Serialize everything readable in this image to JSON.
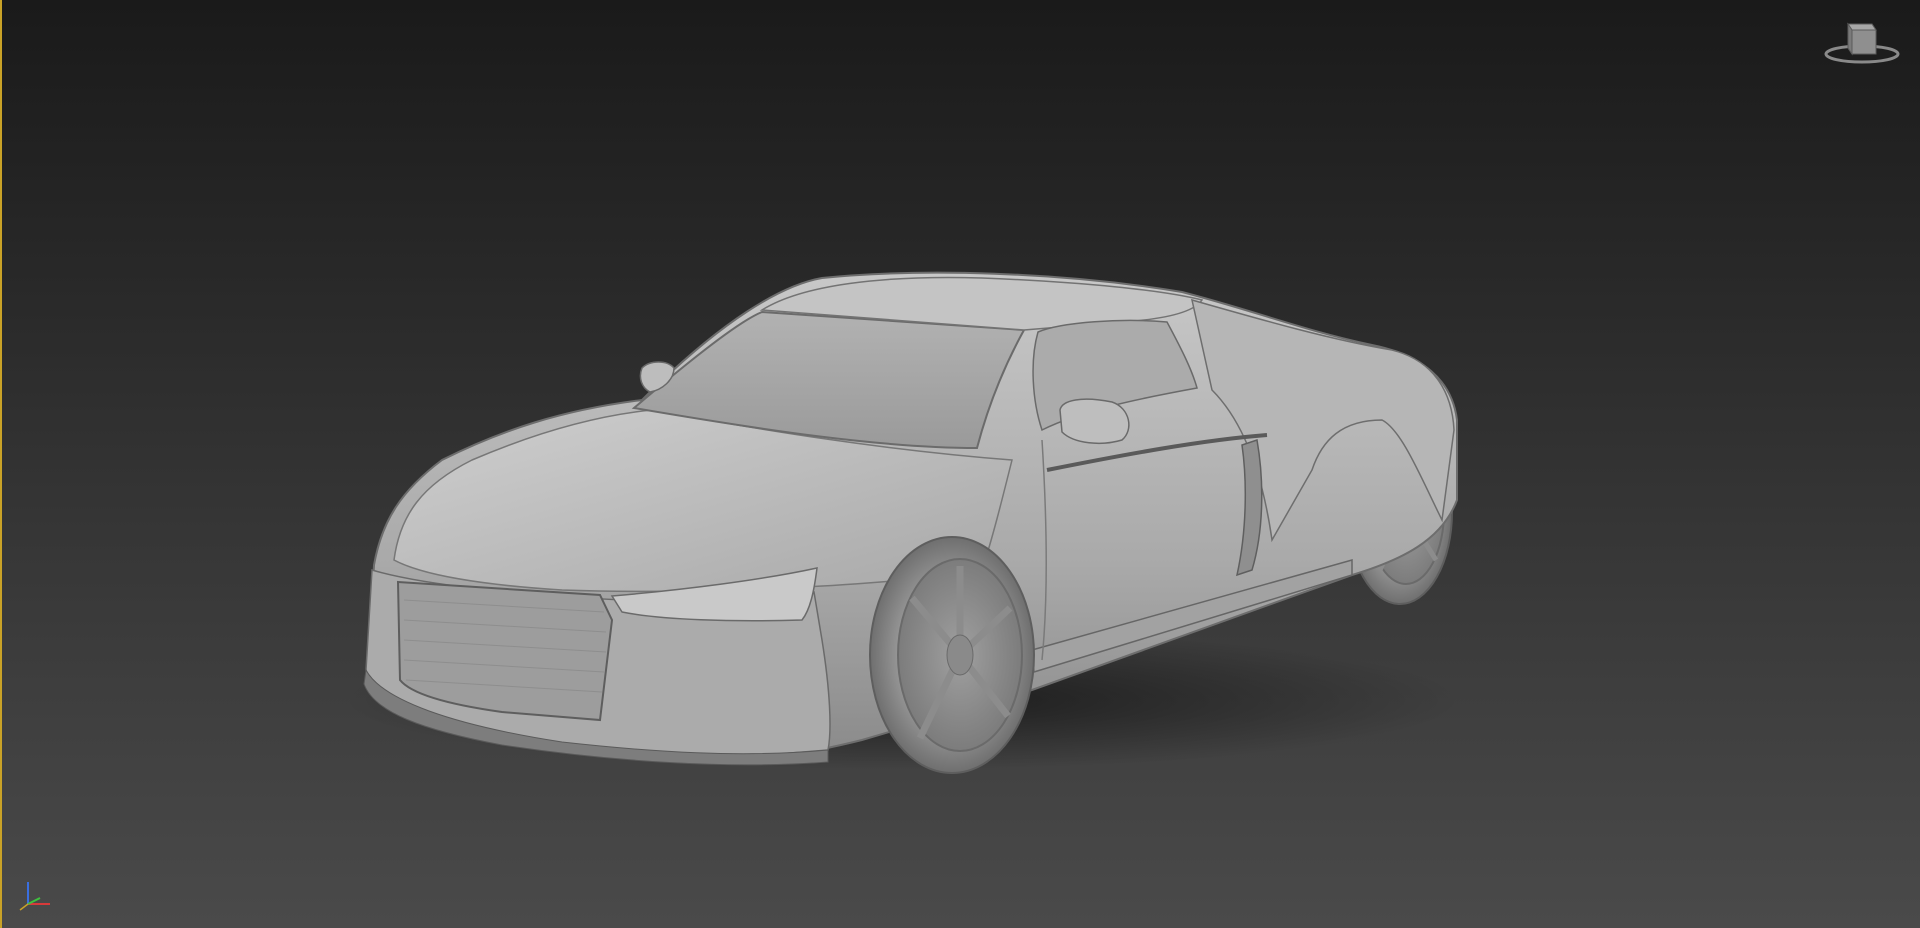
{
  "viewport": {
    "border_color": "#c9a227",
    "background_top": "#1a1a1a",
    "background_bottom": "#4a4a4a"
  },
  "scene": {
    "object": "sports-car-model",
    "shading": "clay",
    "model_color": "#b9b9b9"
  },
  "viewcube": {
    "icon": "viewcube-icon"
  },
  "axis_gizmo": {
    "icon": "axis-tripod-icon",
    "colors": {
      "x": "#d83a3a",
      "y": "#3ec23e",
      "z": "#3a6fe0"
    }
  }
}
